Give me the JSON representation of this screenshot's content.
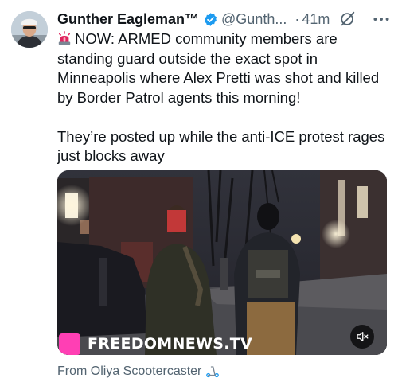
{
  "author": {
    "display_name": "Gunther Eagleman™",
    "handle": "@Gunth...",
    "separator": "·",
    "time": "41m",
    "verified": true,
    "avatar_icon": "profile-photo"
  },
  "tweet": {
    "paragraph_1": "NOW: ARMED community members are standing guard outside the exact spot in Minneapolis where Alex Pretti was shot and killed by Border Patrol agents this morning!",
    "paragraph_2": "They’re posted up while the anti-ICE protest rages just blocks away",
    "leading_icon": "siren-icon"
  },
  "media": {
    "type": "video",
    "watermark": "FREEDOMNEWS.TV",
    "audio_state": "muted"
  },
  "source": {
    "label": "From Oliya Scootercaster",
    "icon": "scooter-icon"
  },
  "colors": {
    "text": "#0f1419",
    "secondary": "#536471",
    "verified": "#1d9bf0",
    "watermark_logo": "#ff3fb4"
  }
}
